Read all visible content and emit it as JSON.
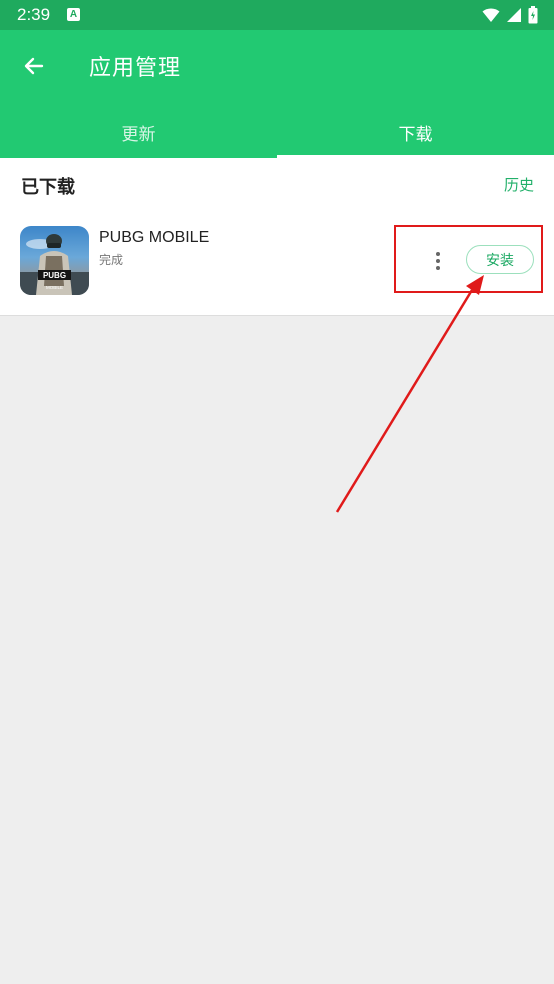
{
  "status_bar": {
    "time": "2:39",
    "notification_icon": "a-letter-icon",
    "icons": [
      "wifi-icon",
      "signal-icon",
      "battery-icon"
    ]
  },
  "app_bar": {
    "back_icon": "arrow-left-icon",
    "title": "应用管理",
    "tabs": [
      {
        "label": "更新",
        "active": false
      },
      {
        "label": "下载",
        "active": true
      }
    ]
  },
  "downloads": {
    "section_title": "已下载",
    "history_label": "历史",
    "items": [
      {
        "icon": "pubg-app-icon",
        "name": "PUBG MOBILE",
        "status": "完成",
        "more_icon": "more-vertical-icon",
        "action_label": "安装"
      }
    ]
  },
  "colors": {
    "status_bar": "#1faa5e",
    "app_bar": "#22c972",
    "accent_text": "#22b06a",
    "annotation": "#e01a1a",
    "background": "#eeeeee"
  },
  "annotation": {
    "highlight_color": "#e01a1a",
    "arrow_color": "#e01a1a"
  }
}
